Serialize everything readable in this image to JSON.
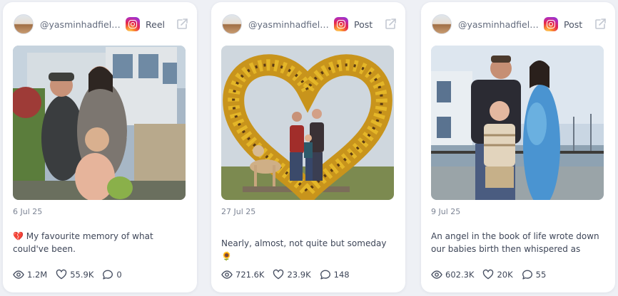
{
  "posts": [
    {
      "handle": "@yasminhadfiel…",
      "platform_icon": "instagram-icon",
      "type": "Reel",
      "date": "6 Jul 25",
      "caption_emoji": "💔",
      "caption": "My favourite memory of what could've been.",
      "views": "1.2M",
      "likes": "55.9K",
      "comments": "0"
    },
    {
      "handle": "@yasminhadfiel…",
      "platform_icon": "instagram-icon",
      "type": "Post",
      "date": "27 Jul 25",
      "caption": "Nearly, almost, not quite but someday",
      "caption_emoji": "🌻",
      "views": "721.6K",
      "likes": "23.9K",
      "comments": "148"
    },
    {
      "handle": "@yasminhadfiel…",
      "platform_icon": "instagram-icon",
      "type": "Post",
      "date": "9 Jul 25",
      "caption": "An angel in the book of life wrote down our babies birth then whispered as she…",
      "views": "602.3K",
      "likes": "20K",
      "comments": "55"
    }
  ],
  "colors": {
    "card_background": "#ffffff",
    "page_background": "#eef0f5",
    "icon_stroke": "#4a5264"
  }
}
